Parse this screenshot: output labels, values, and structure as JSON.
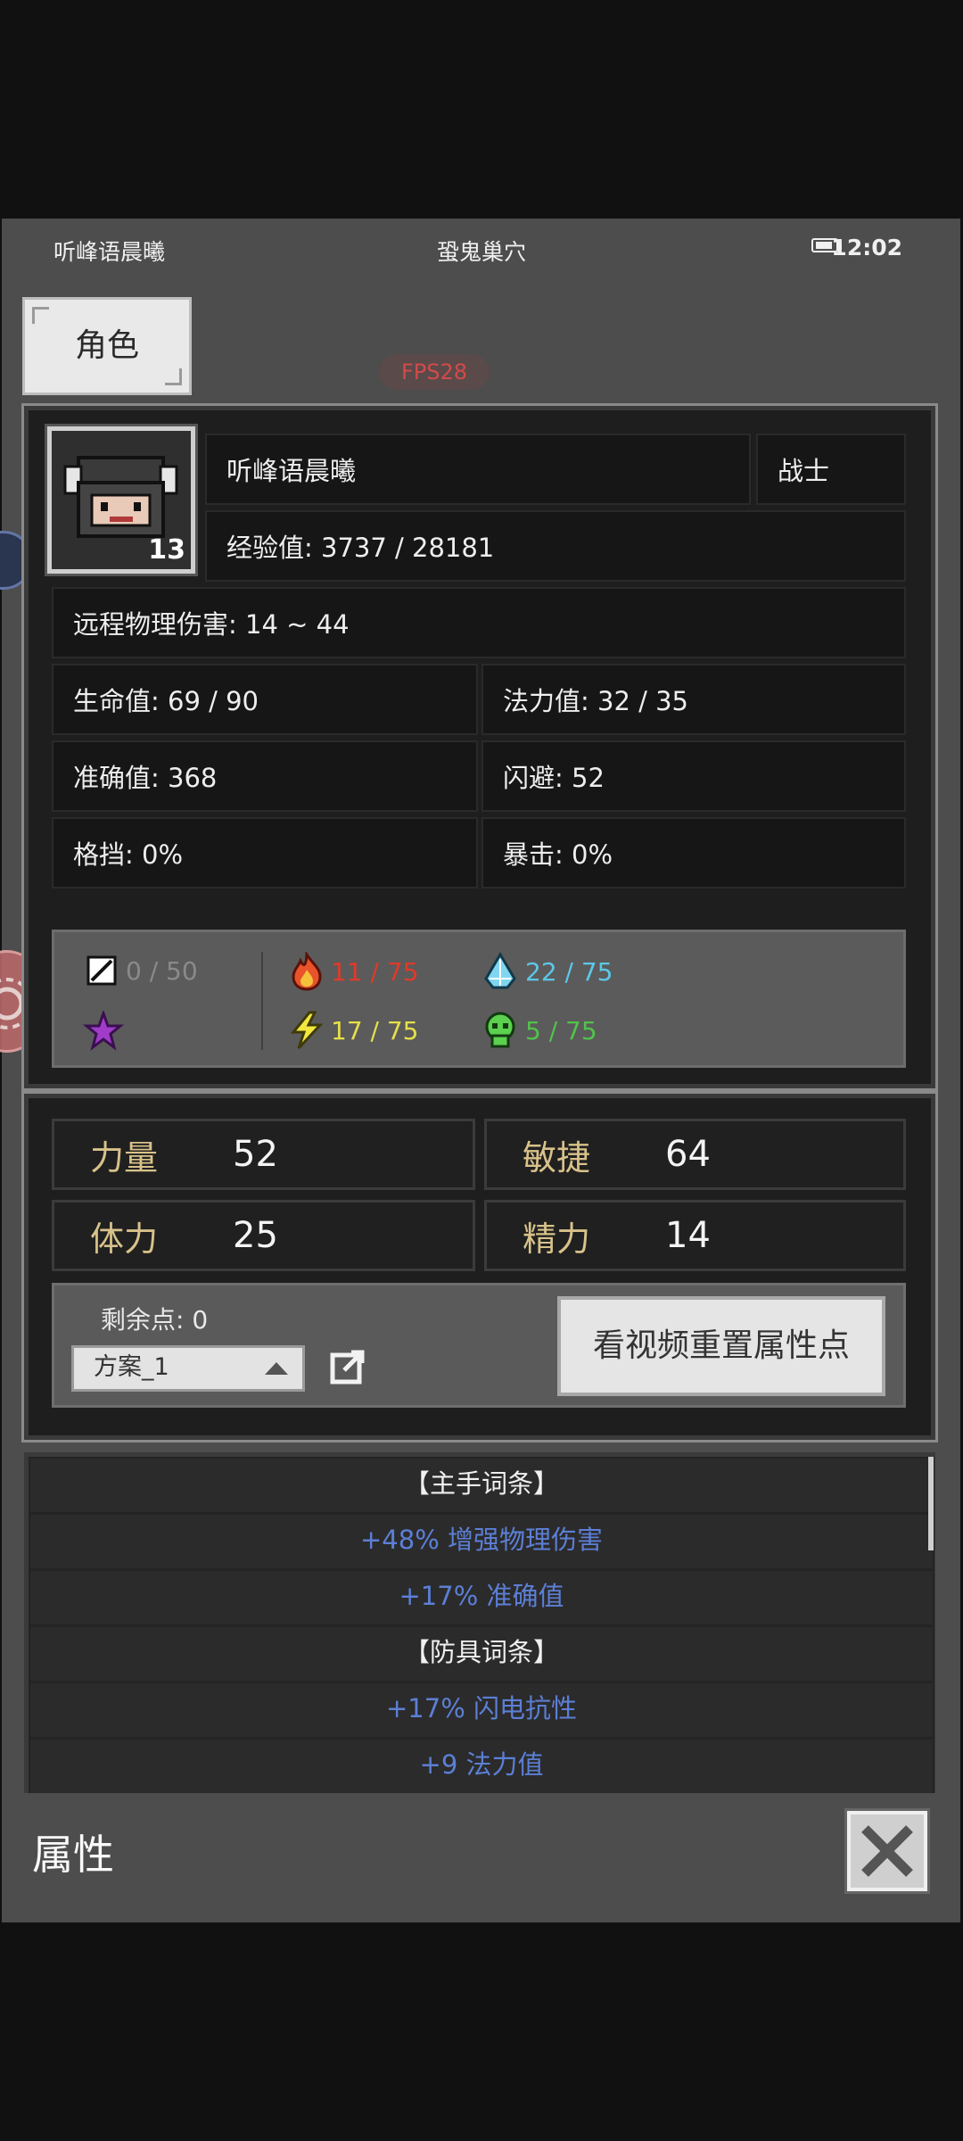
{
  "status_bar": {
    "player_name": "听峰语晨曦",
    "location": "蛩鬼巢穴",
    "time": "12:02"
  },
  "tab": {
    "label": "角色"
  },
  "fps": "FPS28",
  "character": {
    "name": "听峰语晨曦",
    "class": "战士",
    "level": "13",
    "exp": "经验值: 3737 / 28181",
    "damage": "远程物理伤害: 14 ~ 44",
    "hp": "生命值: 69 / 90",
    "mp": "法力值: 32 / 35",
    "accuracy": "准确值: 368",
    "dodge": "闪避: 52",
    "block": "格挡: 0%",
    "crit": "暴击: 0%"
  },
  "resistances": {
    "physical": "0 / 50",
    "fire": "11 / 75",
    "ice": "22 / 75",
    "lightning": "17 / 75",
    "poison": "5 / 75",
    "colors": {
      "fire": "#e03a2a",
      "ice": "#5cc7e8",
      "lightning": "#e6df4a",
      "poison": "#52c24a",
      "physical": "#8a8a8a"
    }
  },
  "attributes": [
    {
      "name": "力量",
      "value": "52"
    },
    {
      "name": "敏捷",
      "value": "64"
    },
    {
      "name": "体力",
      "value": "25"
    },
    {
      "name": "精力",
      "value": "14"
    }
  ],
  "points": {
    "remaining": "剩余点: 0",
    "plan": "方案_1",
    "reset_button": "看视频重置属性点"
  },
  "affixes": [
    {
      "text": "【主手词条】",
      "kind": "head"
    },
    {
      "text": "+48% 增强物理伤害",
      "kind": "val"
    },
    {
      "text": "+17% 准确值",
      "kind": "val"
    },
    {
      "text": "【防具词条】",
      "kind": "head"
    },
    {
      "text": "+17% 闪电抗性",
      "kind": "val"
    },
    {
      "text": "+9 法力值",
      "kind": "val"
    }
  ],
  "footer": {
    "title": "属性"
  }
}
